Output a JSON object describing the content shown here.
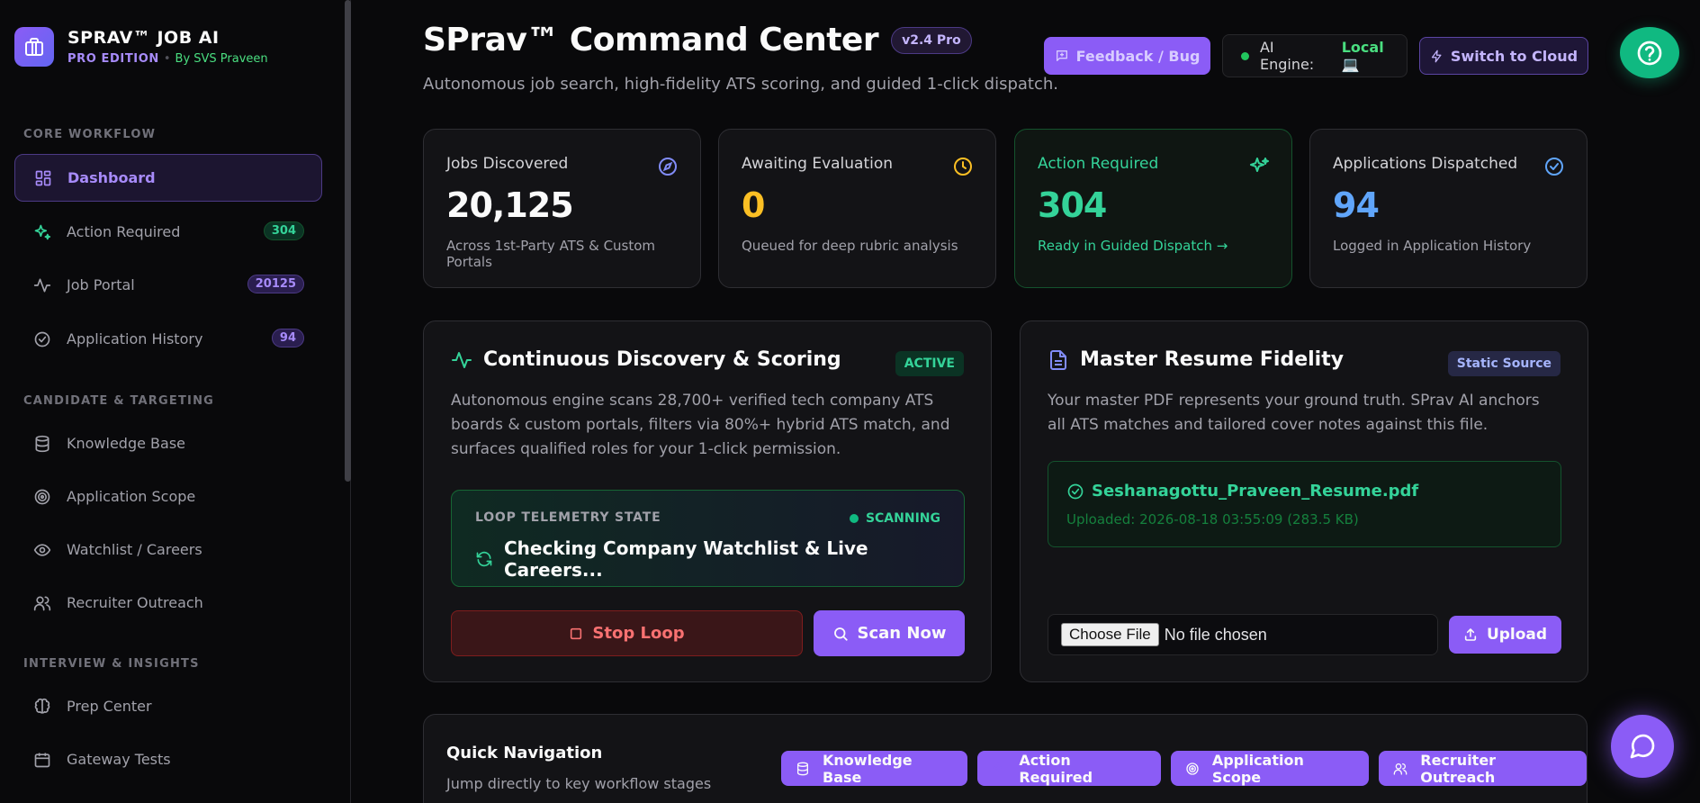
{
  "brand": {
    "title": "SPRAV™ JOB AI",
    "edition": "PRO EDITION",
    "separator": "•",
    "author": "By SVS Praveen"
  },
  "sidebar": {
    "sections": [
      {
        "label": "CORE WORKFLOW"
      },
      {
        "label": "CANDIDATE & TARGETING"
      },
      {
        "label": "INTERVIEW & INSIGHTS"
      }
    ],
    "items": [
      {
        "label": "Dashboard",
        "icon": "dashboard-icon",
        "active": true
      },
      {
        "label": "Action Required",
        "icon": "sparkles-icon",
        "badge": "304"
      },
      {
        "label": "Job Portal",
        "icon": "activity-icon",
        "badge": "20125"
      },
      {
        "label": "Application History",
        "icon": "check-circle-icon",
        "badge": "94"
      },
      {
        "label": "Knowledge Base",
        "icon": "database-icon"
      },
      {
        "label": "Application Scope",
        "icon": "target-icon"
      },
      {
        "label": "Watchlist / Careers",
        "icon": "eye-icon"
      },
      {
        "label": "Recruiter Outreach",
        "icon": "users-icon"
      },
      {
        "label": "Prep Center",
        "icon": "brain-icon"
      },
      {
        "label": "Gateway Tests",
        "icon": "calendar-icon"
      }
    ]
  },
  "header": {
    "title": "SPrav™ Command Center",
    "version": "v2.4 Pro",
    "subtitle": "Autonomous job search, high-fidelity ATS scoring, and guided 1-click dispatch.",
    "feedback_label": "Feedback / Bug",
    "engine_label": "AI Engine:",
    "engine_value": "Local 💻",
    "cloud_label": "Switch to Cloud"
  },
  "stats": [
    {
      "label": "Jobs Discovered",
      "value": "20,125",
      "desc": "Across 1st-Party ATS & Custom Portals",
      "color": "#fafafa",
      "icon": "compass-icon"
    },
    {
      "label": "Awaiting Evaluation",
      "value": "0",
      "desc": "Queued for deep rubric analysis",
      "color": "#fbbf24",
      "icon": "clock-icon"
    },
    {
      "label": "Action Required",
      "value": "304",
      "desc": "Ready in Guided Dispatch →",
      "color": "#34d399",
      "icon": "sparkles-icon"
    },
    {
      "label": "Applications Dispatched",
      "value": "94",
      "desc": "Logged in Application History",
      "color": "#60a5fa",
      "icon": "check-circle-icon"
    }
  ],
  "discovery": {
    "title": "Continuous Discovery & Scoring",
    "tag": "ACTIVE",
    "text": "Autonomous engine scans 28,700+ verified tech company ATS boards & custom portals, filters via 80%+ hybrid ATS match, and surfaces qualified roles for your 1-click permission.",
    "telemetry_label": "LOOP TELEMETRY STATE",
    "telemetry_status": "SCANNING",
    "telemetry_message": "Checking Company Watchlist & Live Careers...",
    "stop_label": "Stop Loop",
    "scan_label": "Scan Now"
  },
  "resume": {
    "title": "Master Resume Fidelity",
    "tag": "Static Source",
    "text": "Your master PDF represents your ground truth. SPrav AI anchors all ATS matches and tailored cover notes against this file.",
    "file_name": "Seshanagottu_Praveen_Resume.pdf",
    "file_meta": "Uploaded: 2026-08-18 03:55:09 (283.5 KB)",
    "choose_label": "Choose File",
    "no_file": "No file chosen",
    "upload_label": "Upload"
  },
  "quicknav": {
    "title": "Quick Navigation",
    "subtitle": "Jump directly to key workflow stages",
    "buttons": [
      {
        "label": "Knowledge Base",
        "icon": "database-icon"
      },
      {
        "label": "Action Required",
        "icon": "sparkles-icon"
      },
      {
        "label": "Application Scope",
        "icon": "target-icon"
      },
      {
        "label": "Recruiter Outreach",
        "icon": "users-icon"
      }
    ]
  },
  "colors": {
    "accent": "#8b5cf6",
    "success": "#10b981",
    "warning": "#fbbf24",
    "info": "#60a5fa",
    "danger": "#f87171"
  }
}
